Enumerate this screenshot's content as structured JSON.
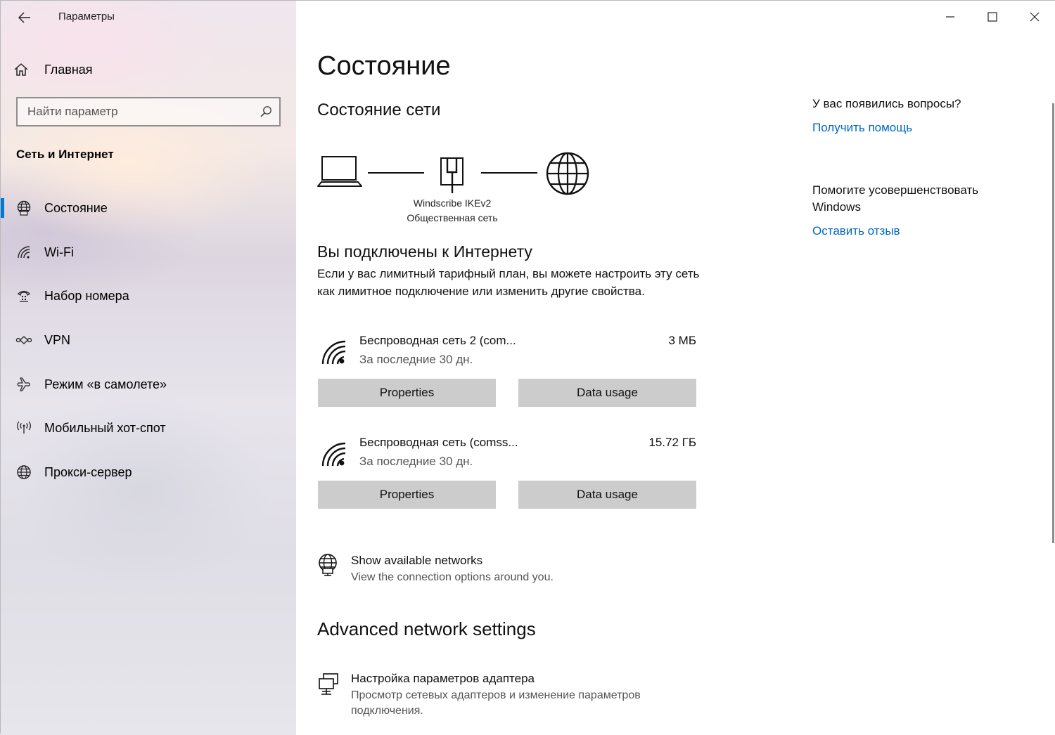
{
  "window": {
    "app_title": "Параметры",
    "controls": [
      "minimize-icon",
      "maximize-icon",
      "close-icon"
    ]
  },
  "sidebar": {
    "home_label": "Главная",
    "search": {
      "placeholder": "Найти параметр",
      "value": ""
    },
    "section_title": "Сеть и Интернет",
    "items": [
      {
        "label": "Состояние",
        "icon": "status-globe-icon",
        "active": true
      },
      {
        "label": "Wi-Fi",
        "icon": "wifi-icon",
        "active": false
      },
      {
        "label": "Набор номера",
        "icon": "dialup-icon",
        "active": false
      },
      {
        "label": "VPN",
        "icon": "vpn-icon",
        "active": false
      },
      {
        "label": "Режим «в самолете»",
        "icon": "airplane-icon",
        "active": false
      },
      {
        "label": "Мобильный хот-спот",
        "icon": "hotspot-icon",
        "active": false
      },
      {
        "label": "Прокси-сервер",
        "icon": "globe-icon",
        "active": false
      }
    ]
  },
  "main": {
    "page_title": "Состояние",
    "network_status_heading": "Состояние сети",
    "diagram": {
      "connection_name": "Windscribe IKEv2",
      "network_type": "Общественная сеть"
    },
    "connected_heading": "Вы подключены к Интернету",
    "connected_text": "Если у вас лимитный тарифный план, вы можете настроить эту сеть как лимитное подключение или изменить другие свойства.",
    "networks": [
      {
        "name": "Беспроводная сеть 2 (com...",
        "period": "За последние 30 дн.",
        "usage": "3 МБ",
        "properties_label": "Properties",
        "data_usage_label": "Data usage"
      },
      {
        "name": "Беспроводная сеть (comss...",
        "period": "За последние 30 дн.",
        "usage": "15.72 ГБ",
        "properties_label": "Properties",
        "data_usage_label": "Data usage"
      }
    ],
    "show_networks": {
      "title": "Show available networks",
      "subtitle": "View the connection options around you."
    },
    "advanced_heading": "Advanced network settings",
    "adapter": {
      "title": "Настройка параметров адаптера",
      "subtitle": "Просмотр сетевых адаптеров и изменение параметров подключения."
    }
  },
  "aside": {
    "questions_heading": "У вас появились вопросы?",
    "help_link": "Получить помощь",
    "improve_heading": "Помогите усовершенствовать Windows",
    "feedback_link": "Оставить отзыв"
  },
  "colors": {
    "accent": "#0078d7",
    "link": "#0067c0",
    "button_bg": "#cccccc"
  }
}
